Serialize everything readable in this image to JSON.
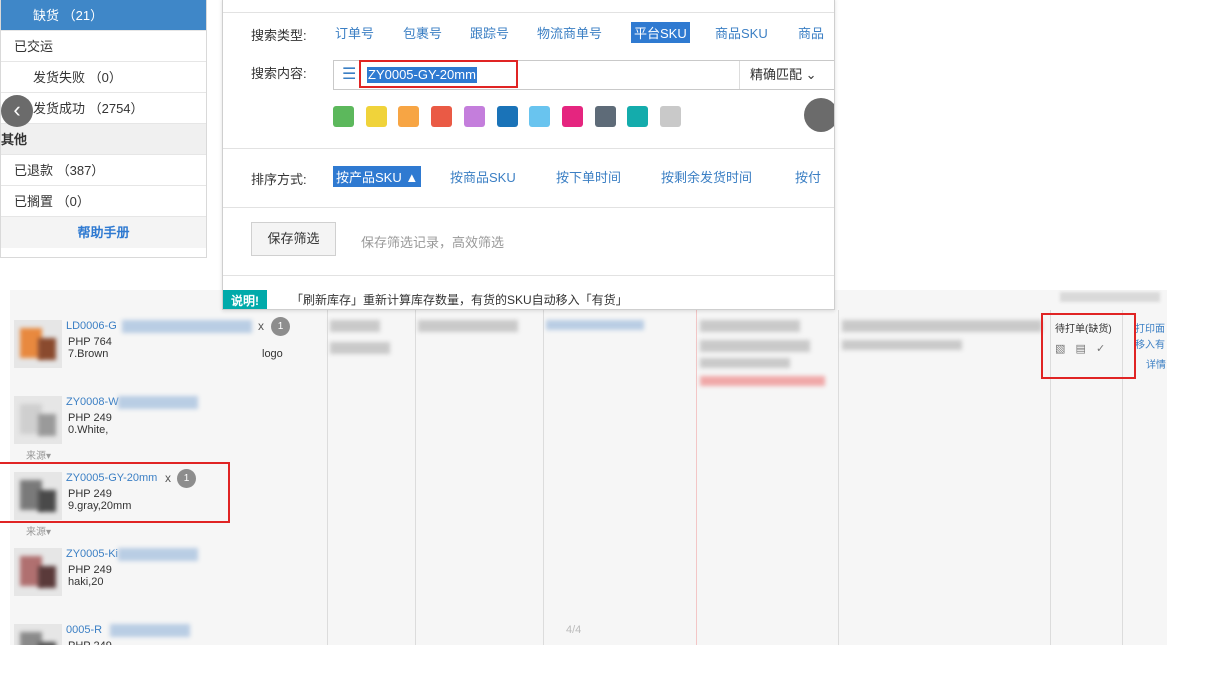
{
  "sidebar": {
    "items": [
      {
        "label": "缺货 （21）",
        "kind": "indent",
        "active": true
      },
      {
        "label": "已交运",
        "kind": "top"
      },
      {
        "label": "发货失败 （0）",
        "kind": "indent"
      },
      {
        "label": "发货成功 （2754）",
        "kind": "indent"
      },
      {
        "label": "其他",
        "kind": "group"
      },
      {
        "label": "已退款 （387）",
        "kind": "top"
      },
      {
        "label": "已搁置 （0）",
        "kind": "top"
      },
      {
        "label": "帮助手册",
        "kind": "help"
      }
    ],
    "back_icon": "chevron-left-icon"
  },
  "filter": {
    "search_type_label": "搜索类型:",
    "search_types": [
      "订单号",
      "包裹号",
      "跟踪号",
      "物流商单号",
      "平台SKU",
      "商品SKU",
      "商品"
    ],
    "search_type_selected": "平台SKU",
    "search_content_label": "搜索内容:",
    "search_value": "ZY0005-GY-20mm",
    "match_mode": "精确匹配",
    "colors": [
      "#5cb85c",
      "#f0d33a",
      "#f7a544",
      "#ea5a45",
      "#c47edc",
      "#1a73b8",
      "#69c4ef",
      "#e5257f",
      "#5e6b78",
      "#14acac",
      "#c9c9c9"
    ],
    "sort_label": "排序方式:",
    "sort_options": [
      "按产品SKU ▲",
      "按商品SKU",
      "按下单时间",
      "按剩余发货时间",
      "按付"
    ],
    "sort_selected": "按产品SKU ▲",
    "save_button": "保存筛选",
    "save_hint": "保存筛选记录，高效筛选",
    "note_badge": "说明!",
    "note_text": "「刷新库存」重新计算库存数量，有货的SKU自动移入「有货」"
  },
  "table": {
    "products": [
      {
        "sku": "LD0006-G",
        "price": "PHP 764",
        "attr": "7.Brown",
        "attr_tail": "logo",
        "qty": "1",
        "show_source": false
      },
      {
        "sku": "ZY0008-W",
        "price": "PHP 249",
        "attr": "0.White,",
        "qty": "",
        "show_source": true
      },
      {
        "sku": "ZY0005-GY-20mm",
        "price": "PHP 249",
        "attr": "9.gray,20mm",
        "qty": "1",
        "show_source": true
      },
      {
        "sku": "ZY0005-Ki",
        "price": "PHP 249",
        "attr": "haki,20",
        "qty": "",
        "show_source": false
      },
      {
        "sku": "0005-R",
        "price": "PHP 249",
        "attr": "",
        "qty": "",
        "show_source": false
      }
    ],
    "x_mark": "x",
    "source_label": "来源",
    "status_label": "待打单(缺货)",
    "side_links": [
      "打印面",
      "移入有",
      "详情"
    ],
    "page_indicator": "4/4"
  }
}
